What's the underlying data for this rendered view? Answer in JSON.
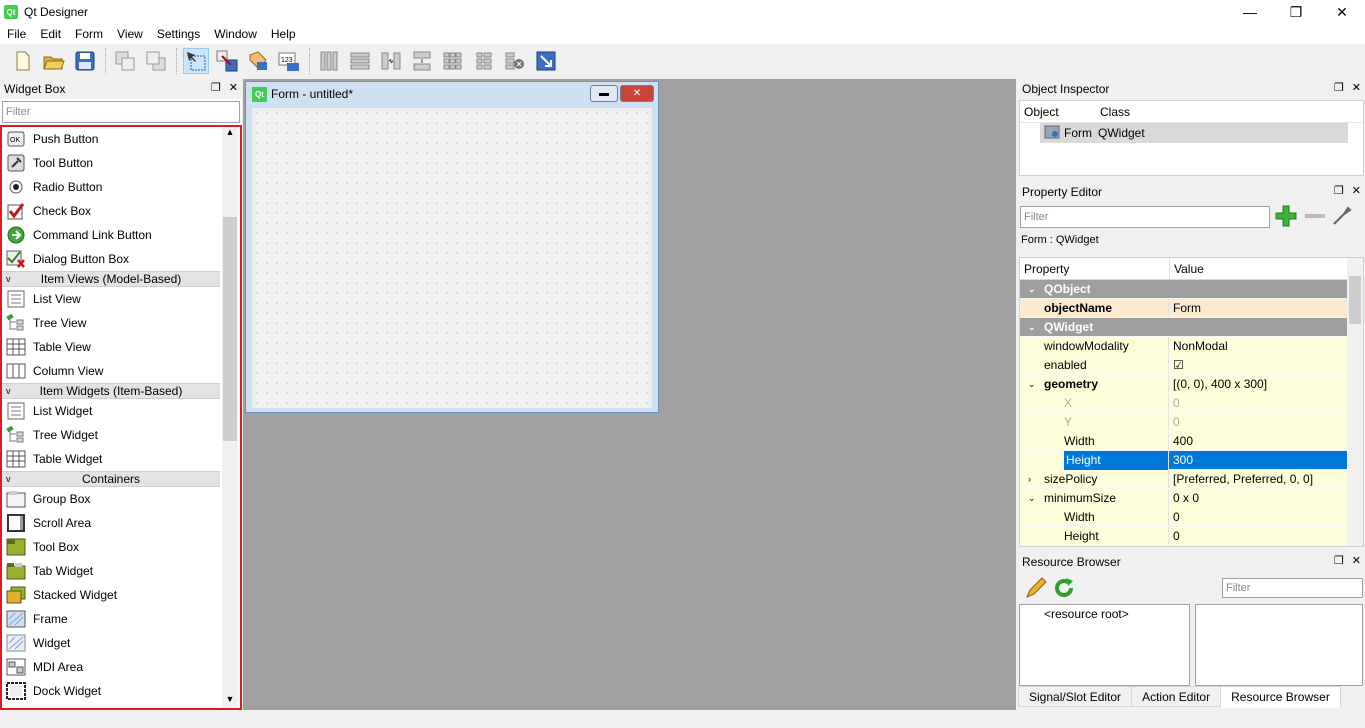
{
  "window": {
    "title": "Qt Designer",
    "app_icon": "Qt",
    "controls": [
      "—",
      "❐",
      "✕"
    ]
  },
  "menu": [
    "File",
    "Edit",
    "Form",
    "View",
    "Settings",
    "Window",
    "Help"
  ],
  "toolbar_icons": [
    "new-icon",
    "open-icon",
    "save-icon",
    "sep",
    "send-to-back-icon",
    "bring-to-front-icon",
    "sep",
    "edit-widgets-icon",
    "edit-signals-slots-icon",
    "edit-buddies-icon",
    "edit-tab-order-icon",
    "sep",
    "layout-horizontal-icon",
    "layout-vertical-icon",
    "layout-h-splitter-icon",
    "layout-v-splitter-icon",
    "layout-grid-icon",
    "layout-form-icon",
    "break-layout-icon",
    "adjust-size-icon"
  ],
  "widget_box": {
    "title": "Widget Box",
    "controls": [
      "❐",
      "✕"
    ],
    "filter_placeholder": "Filter",
    "items": [
      {
        "type": "item",
        "label": "Push Button",
        "icon": "push-button-icon"
      },
      {
        "type": "item",
        "label": "Tool Button",
        "icon": "tool-button-icon"
      },
      {
        "type": "item",
        "label": "Radio Button",
        "icon": "radio-button-icon"
      },
      {
        "type": "item",
        "label": "Check Box",
        "icon": "check-box-icon"
      },
      {
        "type": "item",
        "label": "Command Link Button",
        "icon": "command-link-icon"
      },
      {
        "type": "item",
        "label": "Dialog Button Box",
        "icon": "dialog-button-box-icon"
      },
      {
        "type": "cat",
        "label": "Item Views (Model-Based)"
      },
      {
        "type": "item",
        "label": "List View",
        "icon": "list-view-icon"
      },
      {
        "type": "item",
        "label": "Tree View",
        "icon": "tree-view-icon"
      },
      {
        "type": "item",
        "label": "Table View",
        "icon": "table-view-icon"
      },
      {
        "type": "item",
        "label": "Column View",
        "icon": "column-view-icon"
      },
      {
        "type": "cat",
        "label": "Item Widgets (Item-Based)"
      },
      {
        "type": "item",
        "label": "List Widget",
        "icon": "list-widget-icon"
      },
      {
        "type": "item",
        "label": "Tree Widget",
        "icon": "tree-widget-icon"
      },
      {
        "type": "item",
        "label": "Table Widget",
        "icon": "table-widget-icon"
      },
      {
        "type": "cat",
        "label": "Containers"
      },
      {
        "type": "item",
        "label": "Group Box",
        "icon": "group-box-icon"
      },
      {
        "type": "item",
        "label": "Scroll Area",
        "icon": "scroll-area-icon"
      },
      {
        "type": "item",
        "label": "Tool Box",
        "icon": "tool-box-icon"
      },
      {
        "type": "item",
        "label": "Tab Widget",
        "icon": "tab-widget-icon"
      },
      {
        "type": "item",
        "label": "Stacked Widget",
        "icon": "stacked-widget-icon"
      },
      {
        "type": "item",
        "label": "Frame",
        "icon": "frame-icon"
      },
      {
        "type": "item",
        "label": "Widget",
        "icon": "widget-icon"
      },
      {
        "type": "item",
        "label": "MDI Area",
        "icon": "mdi-area-icon"
      },
      {
        "type": "item",
        "label": "Dock Widget",
        "icon": "dock-widget-icon"
      }
    ]
  },
  "form_window": {
    "title": "Form - untitled*",
    "icon": "Qt"
  },
  "object_inspector": {
    "title": "Object Inspector",
    "controls": [
      "❐",
      "✕"
    ],
    "columns": [
      "Object",
      "Class"
    ],
    "rows": [
      {
        "object": "Form",
        "class": "QWidget"
      }
    ]
  },
  "property_editor": {
    "title": "Property Editor",
    "controls": [
      "❐",
      "✕"
    ],
    "filter_placeholder": "Filter",
    "class_label": "Form : QWidget",
    "columns": [
      "Property",
      "Value"
    ],
    "rows": [
      {
        "kind": "group",
        "name": "QObject",
        "value": "",
        "exp": "v"
      },
      {
        "kind": "obj",
        "name": "objectName",
        "value": "Form",
        "bold": true
      },
      {
        "kind": "group",
        "name": "QWidget",
        "value": "",
        "exp": "v"
      },
      {
        "kind": "wid",
        "name": "windowModality",
        "value": "NonModal"
      },
      {
        "kind": "wid",
        "name": "enabled",
        "value": "☑"
      },
      {
        "kind": "wid",
        "name": "geometry",
        "value": "[(0, 0), 400 x 300]",
        "bold": true,
        "exp": "v"
      },
      {
        "kind": "wid",
        "name": "X",
        "value": "0",
        "indent": true,
        "dim": true
      },
      {
        "kind": "wid",
        "name": "Y",
        "value": "0",
        "indent": true,
        "dim": true
      },
      {
        "kind": "wid",
        "name": "Width",
        "value": "400",
        "indent": true
      },
      {
        "kind": "sel",
        "name": "Height",
        "value": "300",
        "indent": true
      },
      {
        "kind": "wid",
        "name": "sizePolicy",
        "value": "[Preferred, Preferred, 0, 0]",
        "exp": ">"
      },
      {
        "kind": "wid",
        "name": "minimumSize",
        "value": "0 x 0",
        "exp": "v"
      },
      {
        "kind": "wid",
        "name": "Width",
        "value": "0",
        "indent": true
      },
      {
        "kind": "wid",
        "name": "Height",
        "value": "0",
        "indent": true
      }
    ]
  },
  "resource_browser": {
    "title": "Resource Browser",
    "controls": [
      "❐",
      "✕"
    ],
    "filter_placeholder": "Filter",
    "root": "<resource root>"
  },
  "bottom_tabs": [
    "Signal/Slot Editor",
    "Action Editor",
    "Resource Browser"
  ],
  "colors": {
    "accent": "#0078d7",
    "highlight_border": "#e01a22",
    "mdi_bg": "#a0a0a0",
    "qt_green": "#41cd52"
  }
}
